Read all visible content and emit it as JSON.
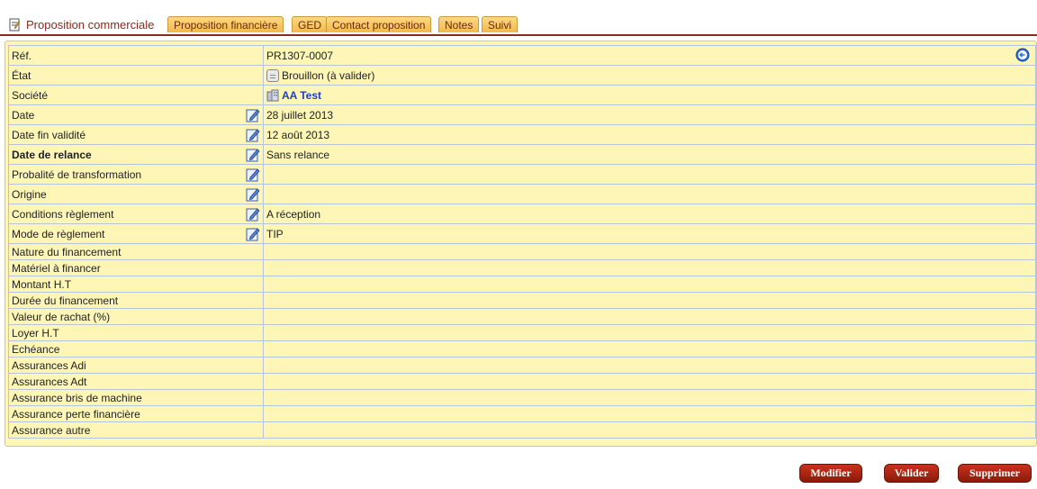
{
  "tabs": {
    "active": "Proposition commerciale",
    "items": [
      "Proposition financière",
      "GED",
      "Contact proposition",
      "Notes",
      "Suivi"
    ]
  },
  "rows": [
    {
      "label": "Réf.",
      "value": "PR1307-0007"
    },
    {
      "label": "État",
      "value": "Brouillon (à valider)"
    },
    {
      "label": "Société",
      "value": "AA Test"
    },
    {
      "label": "Date",
      "value": "28 juillet 2013"
    },
    {
      "label": "Date fin validité",
      "value": "12 août 2013"
    },
    {
      "label": "Date de relance",
      "value": "Sans relance"
    },
    {
      "label": "Probalité de transformation",
      "value": ""
    },
    {
      "label": "Origine",
      "value": ""
    },
    {
      "label": "Conditions règlement",
      "value": "A réception"
    },
    {
      "label": "Mode de règlement",
      "value": "TIP"
    },
    {
      "label": "Nature du financement",
      "value": ""
    },
    {
      "label": "Matériel à financer",
      "value": ""
    },
    {
      "label": "Montant H.T",
      "value": ""
    },
    {
      "label": "Durée du financement",
      "value": ""
    },
    {
      "label": "Valeur de rachat (%)",
      "value": ""
    },
    {
      "label": "Loyer H.T",
      "value": ""
    },
    {
      "label": "Echéance",
      "value": ""
    },
    {
      "label": "Assurances Adi",
      "value": ""
    },
    {
      "label": "Assurances Adt",
      "value": ""
    },
    {
      "label": "Assurance bris de machine",
      "value": ""
    },
    {
      "label": "Assurance perte financière",
      "value": ""
    },
    {
      "label": "Assurance autre",
      "value": ""
    }
  ],
  "actions": {
    "modify": "Modifier",
    "validate": "Valider",
    "delete": "Supprimer"
  },
  "colors": {
    "accent": "#8b2a1e",
    "panel": "#fdf6b7",
    "tab": "#f1b94a",
    "link": "#1f3fbf"
  }
}
